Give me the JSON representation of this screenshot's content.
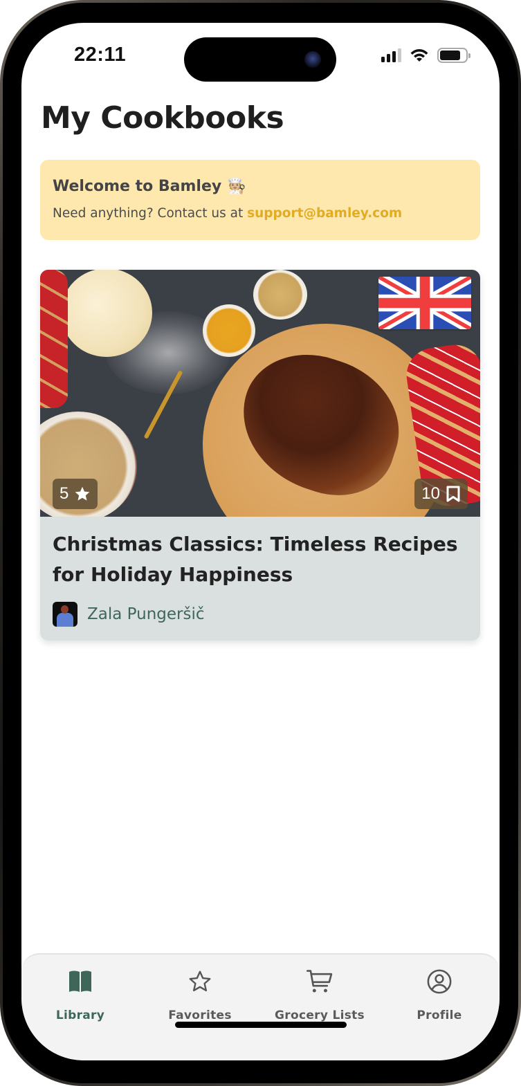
{
  "status_bar": {
    "time": "22:11",
    "signal_bars_active": 3,
    "signal_bars_total": 4,
    "battery_level": 0.8
  },
  "page": {
    "title": "My Cookbooks"
  },
  "welcome": {
    "title": "Welcome to Bamley",
    "emoji": "🧑🏼‍🍳",
    "message": "Need anything? Contact us at",
    "email": "support@bamley.com",
    "background_color": "#fee8ae",
    "link_color": "#e1ab24"
  },
  "cookbooks": [
    {
      "title": "Christmas Classics: Timeless Recipes for Holiday Happiness",
      "language_flag": "uk-flag-icon",
      "rating": "5",
      "rating_icon": "star-icon",
      "recipe_count": "10",
      "recipe_count_icon": "bookmark-icon",
      "author": "Zala Pungeršič",
      "author_color": "#3f6759"
    }
  ],
  "tabbar": {
    "accent_color": "#3e6759",
    "items": [
      {
        "label": "Library",
        "icon": "book-open-icon",
        "active": true
      },
      {
        "label": "Favorites",
        "icon": "star-outline-icon",
        "active": false
      },
      {
        "label": "Grocery Lists",
        "icon": "shopping-cart-icon",
        "active": false
      },
      {
        "label": "Profile",
        "icon": "user-circle-icon",
        "active": false
      }
    ]
  }
}
